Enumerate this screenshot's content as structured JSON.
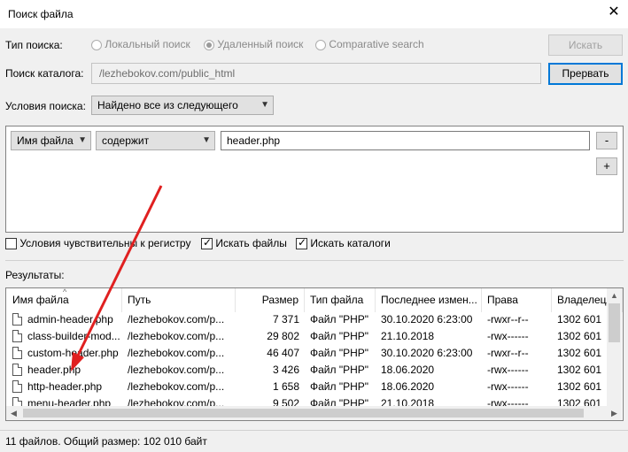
{
  "window": {
    "title": "Поиск файла"
  },
  "search_type": {
    "label": "Тип поиска:",
    "options": [
      {
        "label": "Локальный поиск",
        "selected": false
      },
      {
        "label": "Удаленный поиск",
        "selected": true
      },
      {
        "label": "Comparative search",
        "selected": false
      }
    ]
  },
  "buttons": {
    "search": "Искать",
    "stop": "Прервать",
    "minus": "-",
    "plus": "+"
  },
  "directory": {
    "label": "Поиск каталога:",
    "value": "/lezhebokov.com/public_html"
  },
  "conditions": {
    "label": "Условия поиска:",
    "mode": "Найдено все из следующего",
    "field": "Имя файла",
    "operator": "содержит",
    "value": "header.php"
  },
  "options": [
    {
      "label": "Условия чувствительны к регистру",
      "checked": false
    },
    {
      "label": "Искать файлы",
      "checked": true
    },
    {
      "label": "Искать каталоги",
      "checked": true
    }
  ],
  "results": {
    "label": "Результаты:",
    "columns": [
      "Имя файла",
      "Путь",
      "Размер",
      "Тип файла",
      "Последнее измен...",
      "Права",
      "Владелец/..."
    ],
    "rows": [
      [
        "admin-header.php",
        "/lezhebokov.com/p...",
        "7 371",
        "Файл \"PHP\"",
        "30.10.2020 6:23:00",
        "-rwxr--r--",
        "1302 601"
      ],
      [
        "class-builder-mod...",
        "/lezhebokov.com/p...",
        "29 802",
        "Файл \"PHP\"",
        "21.10.2018",
        "-rwx------",
        "1302 601"
      ],
      [
        "custom-header.php",
        "/lezhebokov.com/p...",
        "46 407",
        "Файл \"PHP\"",
        "30.10.2020 6:23:00",
        "-rwxr--r--",
        "1302 601"
      ],
      [
        "header.php",
        "/lezhebokov.com/p...",
        "3 426",
        "Файл \"PHP\"",
        "18.06.2020",
        "-rwx------",
        "1302 601"
      ],
      [
        "http-header.php",
        "/lezhebokov.com/p...",
        "1 658",
        "Файл \"PHP\"",
        "18.06.2020",
        "-rwx------",
        "1302 601"
      ],
      [
        "menu-header.php",
        "/lezhebokov.com/p...",
        "9 502",
        "Файл \"PHP\"",
        "21.10.2018",
        "-rwx------",
        "1302 601"
      ]
    ]
  },
  "status": "11 файлов. Общий размер: 102 010 байт",
  "colors": {
    "annotation_arrow": "#e02020",
    "focus_border": "#0078d7"
  }
}
